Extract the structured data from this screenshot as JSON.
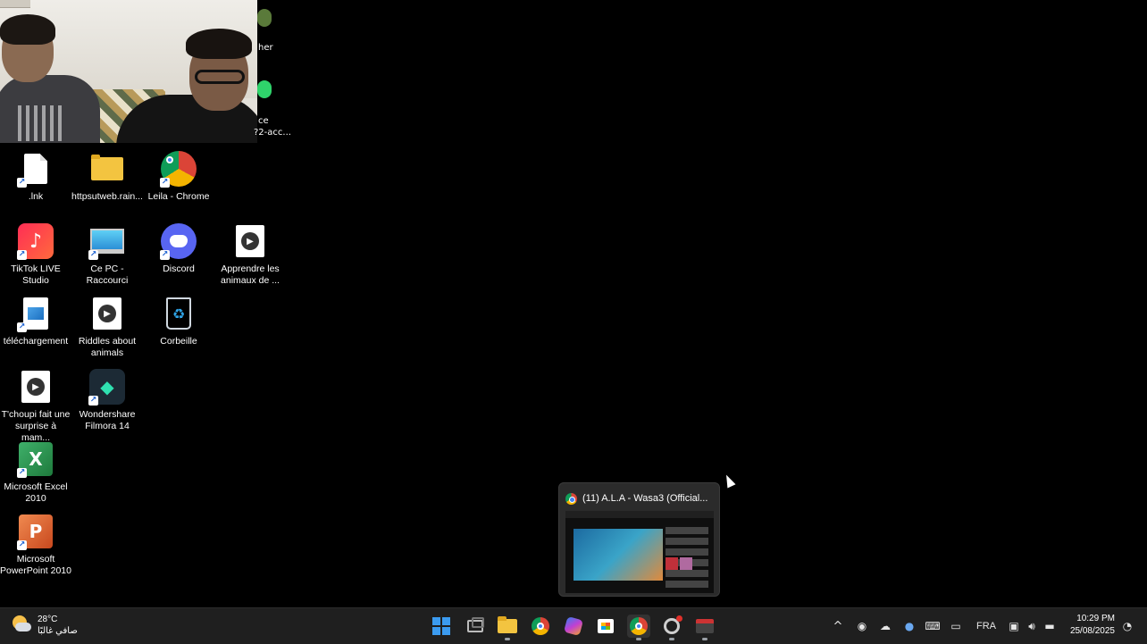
{
  "partial_labels": {
    "top": "her",
    "mid1": "ce",
    "mid2": "?2-acc..."
  },
  "desktop_icons": [
    {
      "label": ".lnk"
    },
    {
      "label": "httpsutweb.rain..."
    },
    {
      "label": "Leila - Chrome"
    },
    {
      "label": "TikTok LIVE Studio"
    },
    {
      "label": "Ce PC - Raccourci"
    },
    {
      "label": "Discord"
    },
    {
      "label": "Apprendre les animaux de ..."
    },
    {
      "label": "téléchargement"
    },
    {
      "label": "Riddles about animals"
    },
    {
      "label": "Corbeille"
    },
    {
      "label": "T'choupi fait une surprise à mam..."
    },
    {
      "label": "Wondershare Filmora 14"
    },
    {
      "label": "Microsoft Excel 2010"
    },
    {
      "label": "Microsoft PowerPoint 2010"
    }
  ],
  "thumbnail": {
    "title": "(11) A.L.A - Wasa3 (Official..."
  },
  "weather": {
    "temp": "28°C",
    "desc": "صافي غالبًا"
  },
  "tray": {
    "language": "FRA",
    "expand_glyph": "^"
  },
  "clock": {
    "time": "10:29 PM",
    "date": "25/08/2025"
  },
  "colors": {
    "accent": "#3b9bf0",
    "taskbar": "#1f1f1f",
    "desktop": "#000000"
  }
}
